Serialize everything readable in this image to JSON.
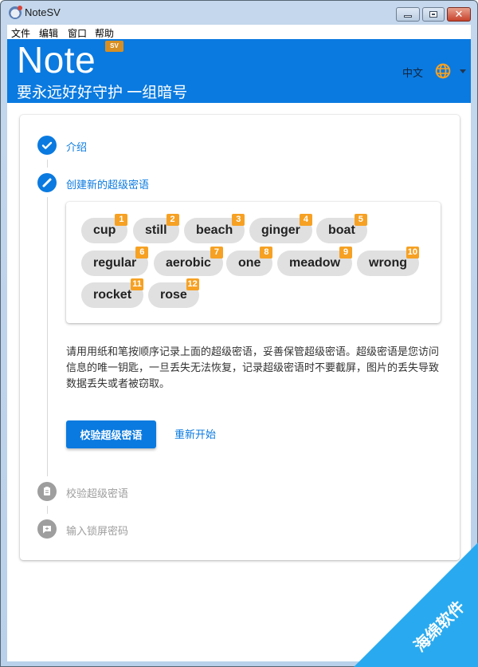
{
  "window": {
    "title": "NoteSV",
    "controls": {
      "minimize": "minimize",
      "maximize": "maximize",
      "close": "✕"
    }
  },
  "menubar": {
    "items": [
      {
        "label": "文件"
      },
      {
        "label": "编辑"
      },
      {
        "label": "窗口"
      },
      {
        "label": "帮助"
      }
    ]
  },
  "header": {
    "brand": "Note",
    "badge": "SV",
    "slogan": "要永远好好守护 一组暗号",
    "language": "中文",
    "language_icon": "globe-icon",
    "accent_color": "#0a7ae0",
    "icon_color": "#f6a123"
  },
  "stepper": {
    "steps": [
      {
        "label": "介绍",
        "icon": "check-icon",
        "state": "completed"
      },
      {
        "label": "创建新的超级密语",
        "icon": "pencil-icon",
        "state": "active"
      },
      {
        "label": "校验超级密语",
        "icon": "clipboard-icon",
        "state": "inactive"
      },
      {
        "label": "输入锁屏密码",
        "icon": "message-plus-icon",
        "state": "inactive"
      }
    ]
  },
  "words": [
    {
      "word": "cup",
      "index": "1"
    },
    {
      "word": "still",
      "index": "2"
    },
    {
      "word": "beach",
      "index": "3"
    },
    {
      "word": "ginger",
      "index": "4"
    },
    {
      "word": "boat",
      "index": "5"
    },
    {
      "word": "regular",
      "index": "6"
    },
    {
      "word": "aerobic",
      "index": "7"
    },
    {
      "word": "one",
      "index": "8"
    },
    {
      "word": "meadow",
      "index": "9"
    },
    {
      "word": "wrong",
      "index": "10"
    },
    {
      "word": "rocket",
      "index": "11"
    },
    {
      "word": "rose",
      "index": "12"
    }
  ],
  "warning_text": "请用用纸和笔按顺序记录上面的超级密语，妥善保管超级密语。超级密语是您访问信息的唯一钥匙，一旦丢失无法恢复，记录超级密语时不要截屏，图片的丢失导致数据丢失或者被窃取。",
  "actions": {
    "verify_label": "校验超级密语",
    "restart_label": "重新开始"
  },
  "watermark": {
    "text": "海绵软件",
    "color": "#29aaf0"
  }
}
